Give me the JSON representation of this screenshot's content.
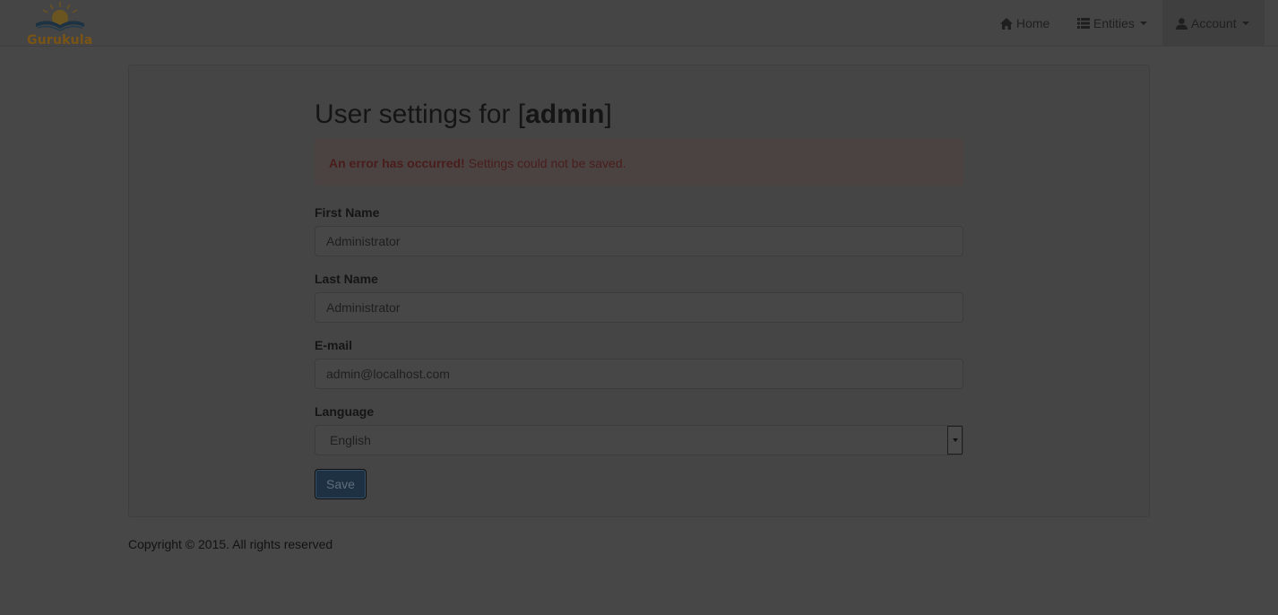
{
  "navbar": {
    "brand_name": "Gurukula",
    "logo_icon": "book-sun-logo",
    "items": [
      {
        "label": "Home",
        "icon": "home-icon"
      },
      {
        "label": "Entities",
        "icon": "list-icon"
      },
      {
        "label": "Account",
        "icon": "user-icon"
      }
    ]
  },
  "page": {
    "title_prefix": "User settings for [",
    "title_user": "admin",
    "title_suffix": "]"
  },
  "alert": {
    "strong": "An error has occurred!",
    "message": " Settings could not be saved."
  },
  "form": {
    "first_name_label": "First Name",
    "first_name_value": "Administrator",
    "last_name_label": "Last Name",
    "last_name_value": "Administrator",
    "email_label": "E-mail",
    "email_value": "admin@localhost.com",
    "language_label": "Language",
    "language_value": "English",
    "save_label": "Save"
  },
  "footer": {
    "text": "Copyright © 2015. All rights reserved"
  },
  "colors": {
    "overlay_background": "#474747",
    "brand_text": "#7a5415",
    "save_button": "#1d3143",
    "alert_text": "#491d1c"
  }
}
